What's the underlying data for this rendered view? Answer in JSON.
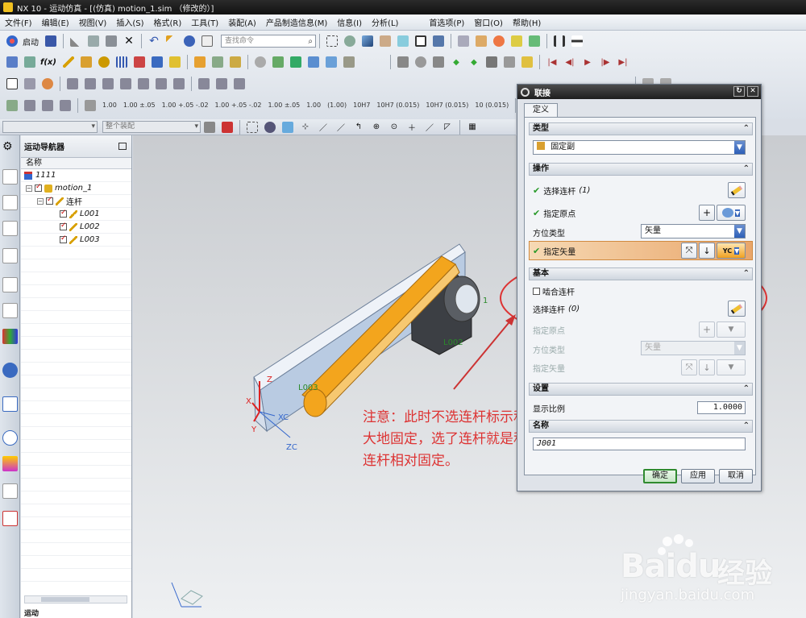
{
  "window": {
    "title": "NX 10 - 运动仿真 - [(仿真) motion_1.sim （修改的）]"
  },
  "menu": [
    "文件(F)",
    "编辑(E)",
    "视图(V)",
    "插入(S)",
    "格式(R)",
    "工具(T)",
    "装配(A)",
    "产品制造信息(M)",
    "信息(I)",
    "分析(L)",
    "首选项(P)",
    "窗口(O)",
    "帮助(H)"
  ],
  "toolbar": {
    "start_label": "启动",
    "search_placeholder": "查找命令",
    "fx_label": "f(x)",
    "tolerances": [
      "1.00",
      "1.00 ±.05",
      "1.00 +.05 -.02",
      "1.00 +.05 -.02",
      "1.00 ±.05",
      "1.00",
      "(1.00)",
      "10H7",
      "10H7 (0.015)",
      "10H7 (0.015)",
      "10 (0.015)"
    ]
  },
  "selection_bar": {
    "filter_value": "",
    "scope_value": "整个装配"
  },
  "navigator": {
    "title": "运动导航器",
    "column_name": "名称",
    "items": [
      {
        "label": "1111",
        "level": 0
      },
      {
        "label": "motion_1",
        "level": 1
      },
      {
        "label": "连杆",
        "level": 2
      },
      {
        "label": "L001",
        "level": 3
      },
      {
        "label": "L002",
        "level": 3
      },
      {
        "label": "L003",
        "level": 3
      }
    ],
    "footer": "运动"
  },
  "graphics": {
    "labels": {
      "z": "Z",
      "x": "X",
      "y": "Y",
      "zc": "ZC",
      "xc": "XC",
      "l002": "L002",
      "l003": "L003",
      "one": "1"
    },
    "annotation": "注意：此时不选连杆标示和大地固定，选了连杆就是和连杆相对固定。"
  },
  "dialog": {
    "title": "联接",
    "tab": "定义",
    "sections": {
      "type": "类型",
      "operation": "操作",
      "base": "基本",
      "settings": "设置",
      "name": "名称"
    },
    "type_value": "固定副",
    "operation": {
      "select_link": "选择连杆",
      "select_link_count": "(1)",
      "specify_origin": "指定原点",
      "orient_type_label": "方位类型",
      "orient_type_value": "矢量",
      "specify_vector": "指定矢量",
      "vector_tag": "YC"
    },
    "base": {
      "snap_link": "啮合连杆",
      "select_link": "选择连杆",
      "select_link_count": "(0)",
      "specify_origin": "指定原点",
      "orient_type_label": "方位类型",
      "orient_type_value": "矢量",
      "specify_vector": "指定矢量"
    },
    "settings": {
      "scale_label": "显示比例",
      "scale_value": "1.0000"
    },
    "name_value": "J001",
    "buttons": {
      "ok": "确定",
      "apply": "应用",
      "cancel": "取消"
    }
  },
  "watermark": {
    "brand": "Bai",
    "brand_suffix": "du",
    "cn": "经验",
    "url": "jingyan.baidu.com"
  },
  "colors": {
    "accent_orange": "#f0a020",
    "annotation_red": "#dd3333",
    "ok_green": "#2a9a2a"
  }
}
